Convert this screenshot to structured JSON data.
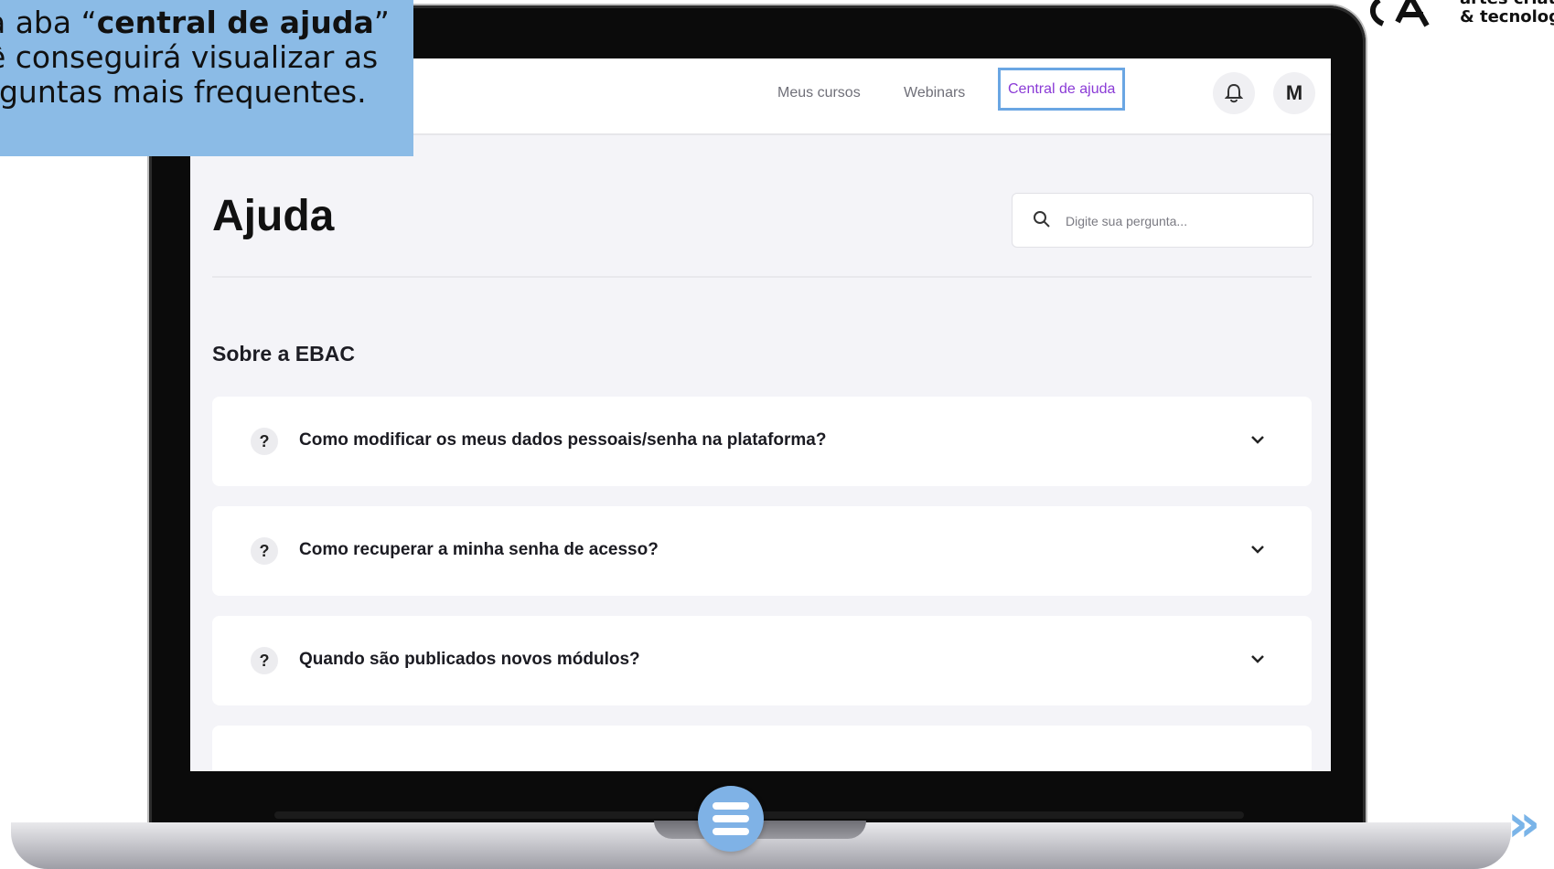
{
  "banner": {
    "line1_pre": "a aba “",
    "line1_bold": "central de ajuda",
    "line1_post": "”",
    "line2": "ê conseguirá visualizar as",
    "line3": "rguntas mais frequentes."
  },
  "logo": {
    "line1": "artes criati",
    "line2": "& tecnologi"
  },
  "nav": {
    "links": [
      "Meus cursos",
      "Webinars",
      "Central de ajuda"
    ],
    "active": "Central de ajuda",
    "bell_icon": "bell-icon",
    "avatar_initial": "M"
  },
  "page": {
    "title": "Ajuda",
    "search_placeholder": "Digite sua pergunta...",
    "section_title": "Sobre a EBAC"
  },
  "faq": [
    {
      "badge": "?",
      "question": "Como modificar os meus dados pessoais/senha na plataforma?"
    },
    {
      "badge": "?",
      "question": "Como recuperar a minha senha de acesso?"
    },
    {
      "badge": "?",
      "question": "Quando são publicados novos módulos?"
    }
  ],
  "colors": {
    "banner": "#8bbbe6",
    "accent": "#8a3ad6",
    "highlight_border": "#6aa6e3",
    "menu_button": "#7fb2e6"
  },
  "icons": {
    "menu": "hamburger-menu-icon",
    "next": "double-chevron-right-icon",
    "search": "search-icon",
    "chevron": "chevron-down-icon"
  }
}
